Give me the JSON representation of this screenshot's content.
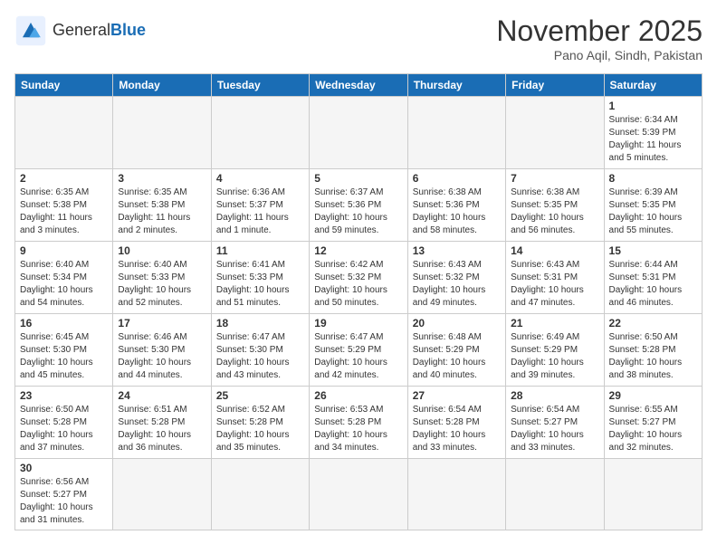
{
  "header": {
    "logo_text_general": "General",
    "logo_text_blue": "Blue",
    "month_title": "November 2025",
    "location": "Pano Aqil, Sindh, Pakistan"
  },
  "days_of_week": [
    "Sunday",
    "Monday",
    "Tuesday",
    "Wednesday",
    "Thursday",
    "Friday",
    "Saturday"
  ],
  "weeks": [
    [
      {
        "day": "",
        "info": ""
      },
      {
        "day": "",
        "info": ""
      },
      {
        "day": "",
        "info": ""
      },
      {
        "day": "",
        "info": ""
      },
      {
        "day": "",
        "info": ""
      },
      {
        "day": "",
        "info": ""
      },
      {
        "day": "1",
        "info": "Sunrise: 6:34 AM\nSunset: 5:39 PM\nDaylight: 11 hours and 5 minutes."
      }
    ],
    [
      {
        "day": "2",
        "info": "Sunrise: 6:35 AM\nSunset: 5:38 PM\nDaylight: 11 hours and 3 minutes."
      },
      {
        "day": "3",
        "info": "Sunrise: 6:35 AM\nSunset: 5:38 PM\nDaylight: 11 hours and 2 minutes."
      },
      {
        "day": "4",
        "info": "Sunrise: 6:36 AM\nSunset: 5:37 PM\nDaylight: 11 hours and 1 minute."
      },
      {
        "day": "5",
        "info": "Sunrise: 6:37 AM\nSunset: 5:36 PM\nDaylight: 10 hours and 59 minutes."
      },
      {
        "day": "6",
        "info": "Sunrise: 6:38 AM\nSunset: 5:36 PM\nDaylight: 10 hours and 58 minutes."
      },
      {
        "day": "7",
        "info": "Sunrise: 6:38 AM\nSunset: 5:35 PM\nDaylight: 10 hours and 56 minutes."
      },
      {
        "day": "8",
        "info": "Sunrise: 6:39 AM\nSunset: 5:35 PM\nDaylight: 10 hours and 55 minutes."
      }
    ],
    [
      {
        "day": "9",
        "info": "Sunrise: 6:40 AM\nSunset: 5:34 PM\nDaylight: 10 hours and 54 minutes."
      },
      {
        "day": "10",
        "info": "Sunrise: 6:40 AM\nSunset: 5:33 PM\nDaylight: 10 hours and 52 minutes."
      },
      {
        "day": "11",
        "info": "Sunrise: 6:41 AM\nSunset: 5:33 PM\nDaylight: 10 hours and 51 minutes."
      },
      {
        "day": "12",
        "info": "Sunrise: 6:42 AM\nSunset: 5:32 PM\nDaylight: 10 hours and 50 minutes."
      },
      {
        "day": "13",
        "info": "Sunrise: 6:43 AM\nSunset: 5:32 PM\nDaylight: 10 hours and 49 minutes."
      },
      {
        "day": "14",
        "info": "Sunrise: 6:43 AM\nSunset: 5:31 PM\nDaylight: 10 hours and 47 minutes."
      },
      {
        "day": "15",
        "info": "Sunrise: 6:44 AM\nSunset: 5:31 PM\nDaylight: 10 hours and 46 minutes."
      }
    ],
    [
      {
        "day": "16",
        "info": "Sunrise: 6:45 AM\nSunset: 5:30 PM\nDaylight: 10 hours and 45 minutes."
      },
      {
        "day": "17",
        "info": "Sunrise: 6:46 AM\nSunset: 5:30 PM\nDaylight: 10 hours and 44 minutes."
      },
      {
        "day": "18",
        "info": "Sunrise: 6:47 AM\nSunset: 5:30 PM\nDaylight: 10 hours and 43 minutes."
      },
      {
        "day": "19",
        "info": "Sunrise: 6:47 AM\nSunset: 5:29 PM\nDaylight: 10 hours and 42 minutes."
      },
      {
        "day": "20",
        "info": "Sunrise: 6:48 AM\nSunset: 5:29 PM\nDaylight: 10 hours and 40 minutes."
      },
      {
        "day": "21",
        "info": "Sunrise: 6:49 AM\nSunset: 5:29 PM\nDaylight: 10 hours and 39 minutes."
      },
      {
        "day": "22",
        "info": "Sunrise: 6:50 AM\nSunset: 5:28 PM\nDaylight: 10 hours and 38 minutes."
      }
    ],
    [
      {
        "day": "23",
        "info": "Sunrise: 6:50 AM\nSunset: 5:28 PM\nDaylight: 10 hours and 37 minutes."
      },
      {
        "day": "24",
        "info": "Sunrise: 6:51 AM\nSunset: 5:28 PM\nDaylight: 10 hours and 36 minutes."
      },
      {
        "day": "25",
        "info": "Sunrise: 6:52 AM\nSunset: 5:28 PM\nDaylight: 10 hours and 35 minutes."
      },
      {
        "day": "26",
        "info": "Sunrise: 6:53 AM\nSunset: 5:28 PM\nDaylight: 10 hours and 34 minutes."
      },
      {
        "day": "27",
        "info": "Sunrise: 6:54 AM\nSunset: 5:28 PM\nDaylight: 10 hours and 33 minutes."
      },
      {
        "day": "28",
        "info": "Sunrise: 6:54 AM\nSunset: 5:27 PM\nDaylight: 10 hours and 33 minutes."
      },
      {
        "day": "29",
        "info": "Sunrise: 6:55 AM\nSunset: 5:27 PM\nDaylight: 10 hours and 32 minutes."
      }
    ],
    [
      {
        "day": "30",
        "info": "Sunrise: 6:56 AM\nSunset: 5:27 PM\nDaylight: 10 hours and 31 minutes."
      },
      {
        "day": "",
        "info": ""
      },
      {
        "day": "",
        "info": ""
      },
      {
        "day": "",
        "info": ""
      },
      {
        "day": "",
        "info": ""
      },
      {
        "day": "",
        "info": ""
      },
      {
        "day": "",
        "info": ""
      }
    ]
  ]
}
